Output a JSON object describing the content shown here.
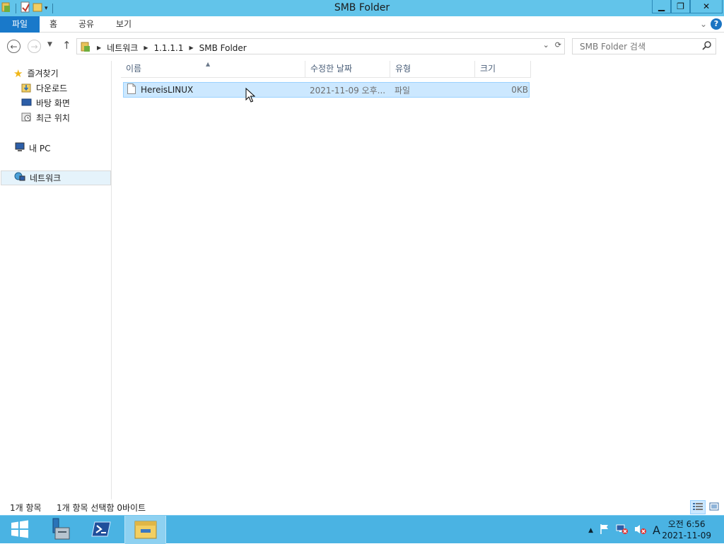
{
  "window": {
    "title": "SMB Folder"
  },
  "ribbon": {
    "tabs": [
      "파일",
      "홈",
      "공유",
      "보기"
    ],
    "help_label": "?"
  },
  "address": {
    "crumbs": [
      "네트워크",
      "1.1.1.1",
      "SMB Folder"
    ]
  },
  "search": {
    "placeholder": "SMB Folder 검색"
  },
  "nav": {
    "favorites": "즐겨찾기",
    "downloads": "다운로드",
    "desktop": "바탕 화면",
    "recent": "최근 위치",
    "this_pc": "내 PC",
    "network": "네트워크"
  },
  "columns": {
    "name": "이름",
    "modified": "수정한 날짜",
    "type": "유형",
    "size": "크기"
  },
  "files": [
    {
      "name": "HereisLINUX",
      "modified": "2021-11-09 오후...",
      "type": "파일",
      "size": "0KB"
    }
  ],
  "status": {
    "item_count": "1개 항목",
    "selection": "1개 항목 선택함 0바이트"
  },
  "clock": {
    "time": "오전 6:56",
    "date": "2021-11-09"
  },
  "tray": {
    "ime": "A"
  },
  "colors": {
    "titlebar": "#62c4ea",
    "file_tab": "#1979ca",
    "taskbar": "#4ab3e3",
    "selection": "#cce8ff"
  }
}
